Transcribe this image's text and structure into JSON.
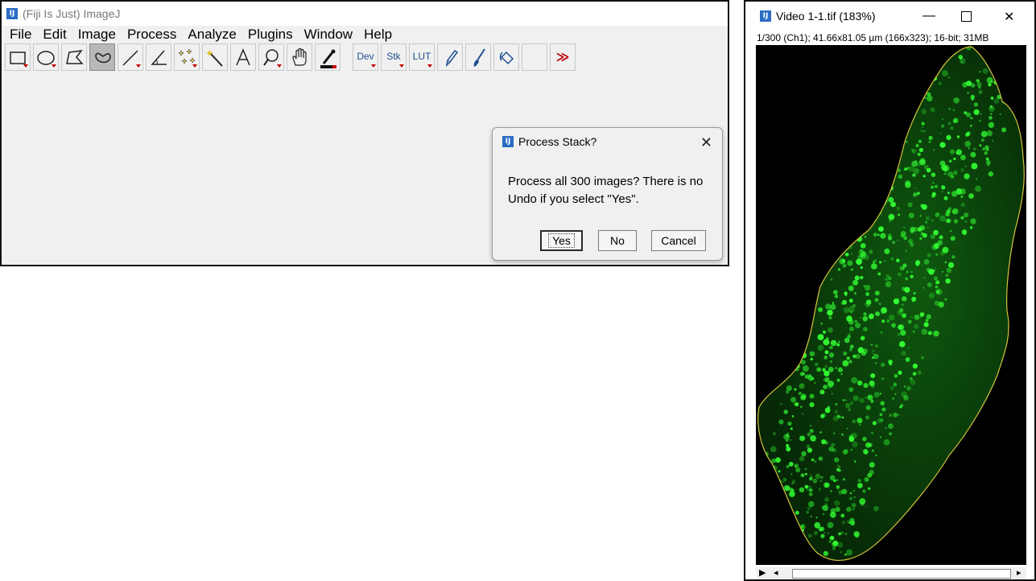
{
  "imagej_window": {
    "title": "(Fiji Is Just) ImageJ",
    "menu": [
      "File",
      "Edit",
      "Image",
      "Process",
      "Analyze",
      "Plugins",
      "Window",
      "Help"
    ],
    "toolbar": {
      "dev_label": "Dev",
      "stk_label": "Stk",
      "lut_label": "LUT",
      "more_glyph": "≫"
    }
  },
  "dialog": {
    "title": "Process Stack?",
    "message": "Process all 300 images? There is no Undo if you select \"Yes\".",
    "close_glyph": "✕",
    "buttons": {
      "yes": "Yes",
      "no": "No",
      "cancel": "Cancel"
    }
  },
  "image_window": {
    "title": "Video 1-1.tif (183%)",
    "info": "1/300 (Ch1); 41.66x81.05 µm (166x323); 16-bit; 31MB",
    "controls": {
      "minimize": "—",
      "close": "✕"
    },
    "scrollbar": {
      "play": "▶",
      "left": "◂",
      "right": "▸"
    }
  },
  "colors": {
    "cell_fluorescence": "#33ff33",
    "outline": "#d4c43a",
    "canvas_bg": "#000000"
  }
}
